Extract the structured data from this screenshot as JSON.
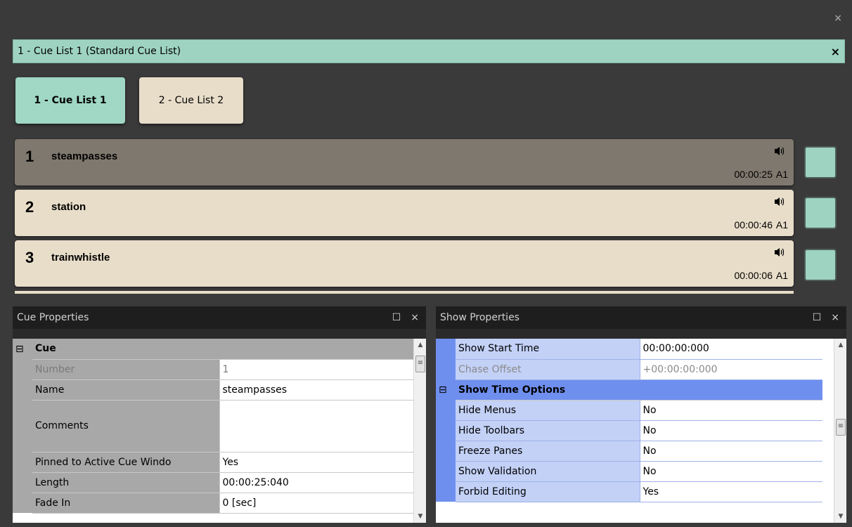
{
  "window": {
    "close_glyph": "×"
  },
  "cue_list_header": {
    "title": "1 - Cue List 1 (Standard Cue List)",
    "close_glyph": "×"
  },
  "tabs": [
    {
      "label": "1 - Cue List 1",
      "active": true
    },
    {
      "label": "2 - Cue List 2",
      "active": false
    }
  ],
  "cues": [
    {
      "number": "1",
      "name": "steampasses",
      "duration": "00:00:25",
      "output": "A1",
      "icon": "speaker-icon",
      "selected": true
    },
    {
      "number": "2",
      "name": "station",
      "duration": "00:00:46",
      "output": "A1",
      "icon": "speaker-icon",
      "selected": false
    },
    {
      "number": "3",
      "name": "trainwhistle",
      "duration": "00:00:06",
      "output": "A1",
      "icon": "speaker-icon",
      "selected": false
    }
  ],
  "cue_properties": {
    "title": "Cue Properties",
    "maximize_glyph": "☐",
    "close_glyph": "×",
    "category": {
      "expander": "⊟",
      "label": "Cue"
    },
    "rows": [
      {
        "label": "Number",
        "value": "1",
        "disabled": true
      },
      {
        "label": "Name",
        "value": "steampasses"
      },
      {
        "label": "Comments",
        "value": ""
      },
      {
        "label": "Pinned to Active Cue Windo",
        "value": "Yes"
      },
      {
        "label": "Length",
        "value": "00:00:25:040"
      },
      {
        "label": "Fade In",
        "value": "0 [sec]"
      }
    ]
  },
  "show_properties": {
    "title": "Show Properties",
    "maximize_glyph": "☐",
    "close_glyph": "×",
    "rows_before": [
      {
        "label": "Show Start Time",
        "value": "00:00:00:000"
      },
      {
        "label": "Chase Offset",
        "value": "+00:00:00:000",
        "disabled": true
      }
    ],
    "category": {
      "expander": "⊟",
      "label": "Show Time Options"
    },
    "rows_after": [
      {
        "label": "Hide Menus",
        "value": "No"
      },
      {
        "label": "Hide Toolbars",
        "value": "No"
      },
      {
        "label": "Freeze Panes",
        "value": "No"
      },
      {
        "label": "Show Validation",
        "value": "No"
      },
      {
        "label": "Forbid Editing",
        "value": "Yes"
      }
    ]
  },
  "colors": {
    "accent_teal": "#9ed3c2",
    "cue_row_bg": "#e8ddc9",
    "cue_row_selected_bg": "#7f786e",
    "show_category_blue": "#6f8fef"
  }
}
